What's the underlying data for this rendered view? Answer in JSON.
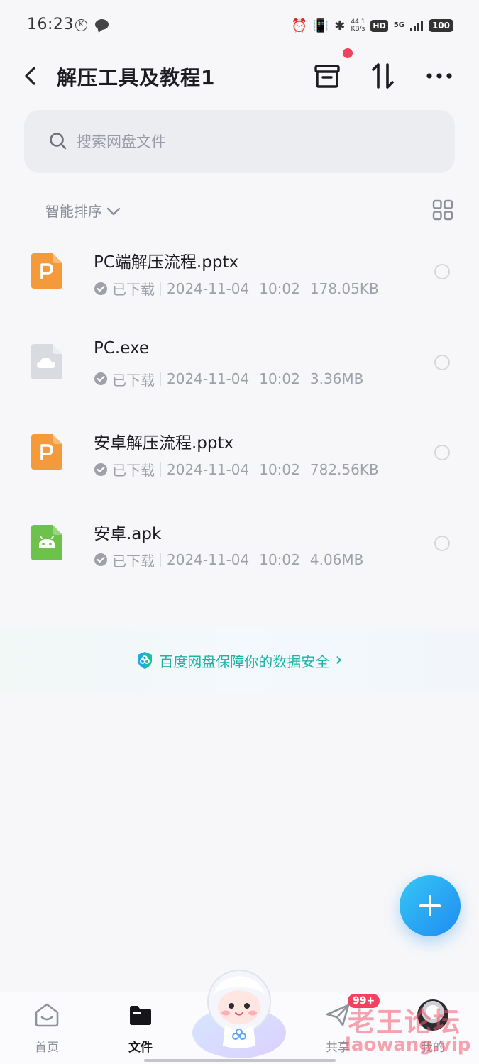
{
  "status_bar": {
    "time": "16:23",
    "k_badge": "K",
    "net_speed_value": "44.1",
    "net_speed_unit": "KB/s",
    "hd": "HD",
    "network": "5G",
    "battery": "100"
  },
  "header": {
    "title": "解压工具及教程1"
  },
  "search": {
    "placeholder": "搜索网盘文件"
  },
  "sort": {
    "label": "智能排序"
  },
  "files": [
    {
      "name": "PC端解压流程.pptx",
      "status": "已下载",
      "date": "2024-11-04",
      "time": "10:02",
      "size": "178.05KB",
      "type_icon": "ppt-file-icon"
    },
    {
      "name": "PC.exe",
      "status": "已下载",
      "date": "2024-11-04",
      "time": "10:02",
      "size": "3.36MB",
      "type_icon": "exe-cloud-file-icon"
    },
    {
      "name": "安卓解压流程.pptx",
      "status": "已下载",
      "date": "2024-11-04",
      "time": "10:02",
      "size": "782.56KB",
      "type_icon": "ppt-file-icon"
    },
    {
      "name": "安卓.apk",
      "status": "已下载",
      "date": "2024-11-04",
      "time": "10:02",
      "size": "4.06MB",
      "type_icon": "apk-android-file-icon"
    }
  ],
  "security_banner": {
    "text": "百度网盘保障你的数据安全",
    "chevron": "›"
  },
  "bottom_nav": {
    "home": "首页",
    "files": "文件",
    "share": "共享",
    "share_badge": "99+",
    "mine": "我的"
  },
  "watermark": {
    "line1": "老王论坛",
    "line2": "laowang.vip"
  },
  "colors": {
    "accent": "#1f8bf2",
    "ppt_orange": "#f59a3a",
    "apk_green": "#6cc24a",
    "security_teal": "#20b2a7",
    "badge_red": "#f3425f"
  }
}
